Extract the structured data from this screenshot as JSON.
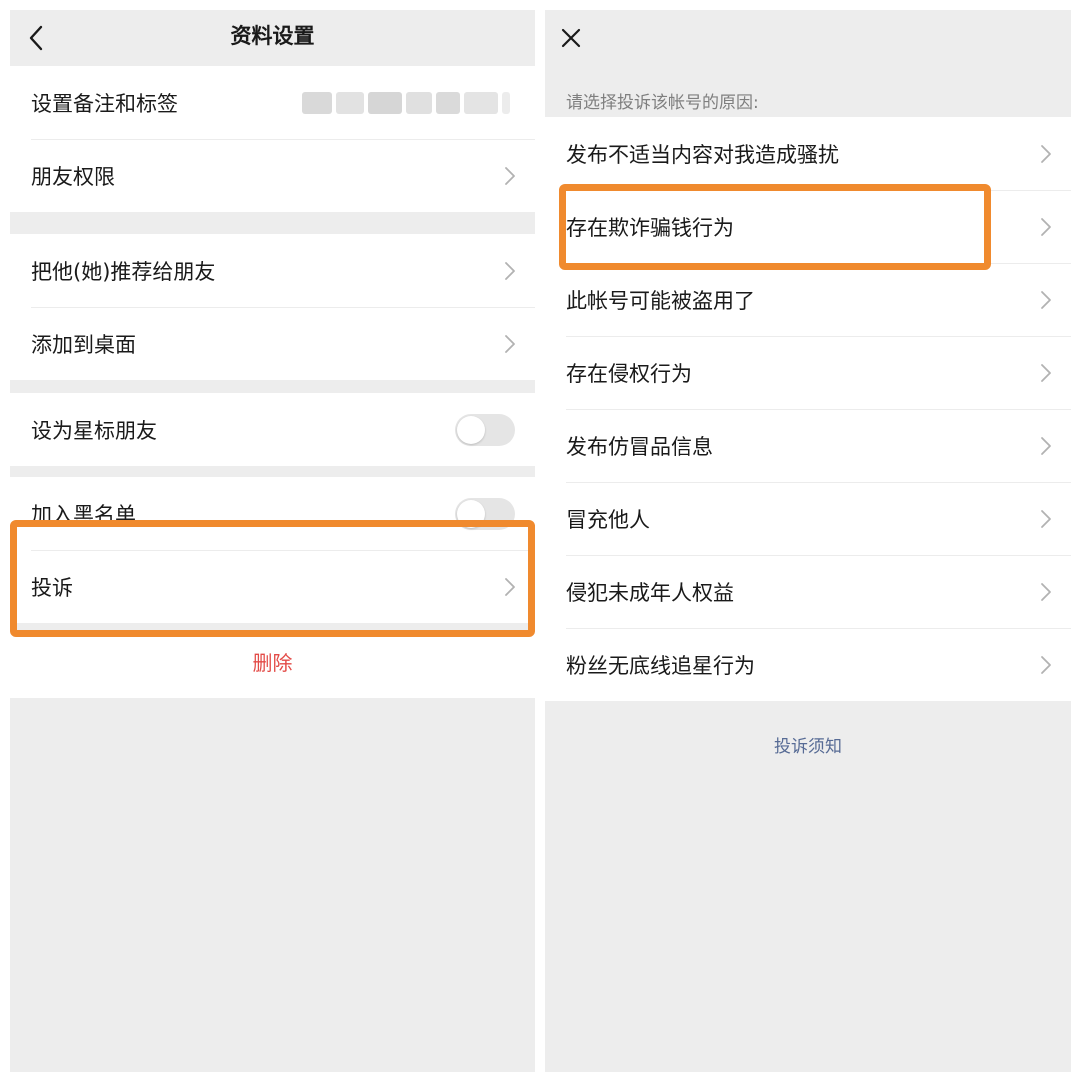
{
  "left": {
    "nav": {
      "title": "资料设置",
      "back_icon": "chevron-left-icon"
    },
    "rows": [
      {
        "label": "设置备注和标签",
        "value": ""
      },
      {
        "label": "朋友权限"
      },
      {
        "label": "把他(她)推荐给朋友"
      },
      {
        "label": "添加到桌面"
      },
      {
        "label": "设为星标朋友",
        "toggle": false
      },
      {
        "label": "加入黑名单",
        "toggle": false
      },
      {
        "label": "投诉"
      }
    ],
    "delete_label": "删除"
  },
  "right": {
    "nav": {
      "close_icon": "close-icon"
    },
    "hint": "请选择投诉该帐号的原因:",
    "reasons": [
      "发布不适当内容对我造成骚扰",
      "存在欺诈骗钱行为",
      "此帐号可能被盗用了",
      "存在侵权行为",
      "发布仿冒品信息",
      "冒充他人",
      "侵犯未成年人权益",
      "粉丝无底线追星行为"
    ],
    "footer_link": "投诉须知"
  },
  "colors": {
    "background": "#ededed",
    "highlight": "#f08a2e",
    "danger": "#e34b47",
    "link": "#576b95"
  }
}
